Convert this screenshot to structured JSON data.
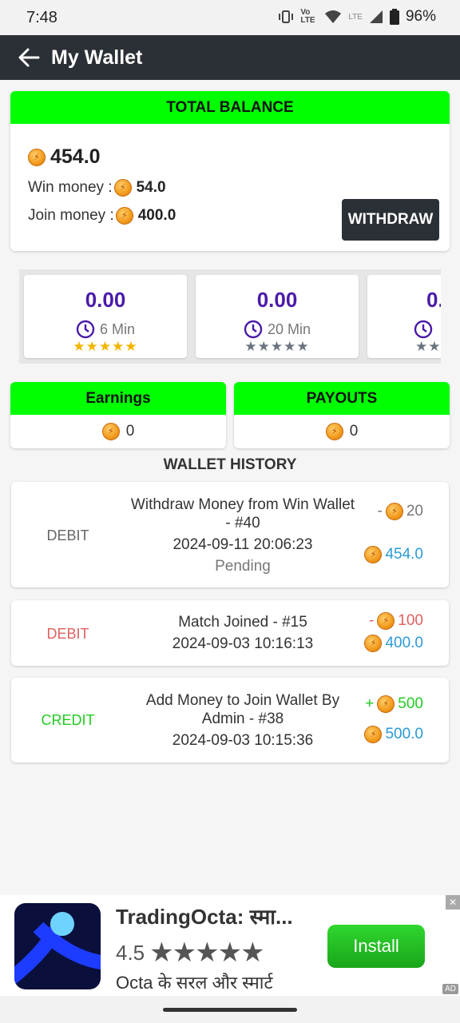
{
  "status": {
    "time": "7:48",
    "lte_label": "Vo LTE",
    "lte2_label": "LTE",
    "battery": "96%"
  },
  "appbar": {
    "title": "My Wallet"
  },
  "balance": {
    "header": "TOTAL BALANCE",
    "total": "454.0",
    "win_label": "Win money :",
    "win_value": "54.0",
    "join_label": "Join money :",
    "join_value": "400.0",
    "withdraw_label": "WITHDRAW"
  },
  "tournaments": [
    {
      "amount": "0.00",
      "duration": "6 Min",
      "stars": "★★★★★",
      "star_color": "#f5b400"
    },
    {
      "amount": "0.00",
      "duration": "20 Min",
      "stars": "★★★★★",
      "star_color": "#6b7380"
    },
    {
      "amount": "0.",
      "duration": "",
      "stars": "★★",
      "star_color": "#6b7380"
    }
  ],
  "earnings": {
    "label": "Earnings",
    "value": "0"
  },
  "payouts": {
    "label": "PAYOUTS",
    "value": "0"
  },
  "history": {
    "title": "WALLET HISTORY",
    "items": [
      {
        "type": "DEBIT",
        "type_color": "#666666",
        "line1": "Withdraw Money from Win Wallet",
        "line2": "- #40",
        "date": "2024-09-11 20:06:23",
        "status": "Pending",
        "sign": "-",
        "amount": "20",
        "amount_color": "#777777",
        "balance": "454.0"
      },
      {
        "type": "DEBIT",
        "type_color": "#e06060",
        "line1": "Match Joined - #15",
        "date": "2024-09-03 10:16:13",
        "sign": "-",
        "amount": "100",
        "amount_color": "#e06060",
        "balance": "400.0"
      },
      {
        "type": "CREDIT",
        "type_color": "#22cc22",
        "line1": "Add Money to Join Wallet By",
        "line2": "Admin - #38",
        "date": "2024-09-03 10:15:36",
        "sign": "+",
        "amount": "500",
        "amount_color": "#22cc22",
        "balance": "500.0"
      }
    ]
  },
  "ad": {
    "app_name": "TradingOcta: स्मा...",
    "rating": "4.5",
    "stars": "★★★★★",
    "subtitle": "Octa के सरल और स्मार्ट",
    "install_label": "Install",
    "ad_tag": "AD",
    "close_label": "✕"
  },
  "colors": {
    "accent_green": "#00ff00",
    "appbar": "#2b3036",
    "purple": "#4a1aa8",
    "balance_blue": "#2a9ad8"
  }
}
